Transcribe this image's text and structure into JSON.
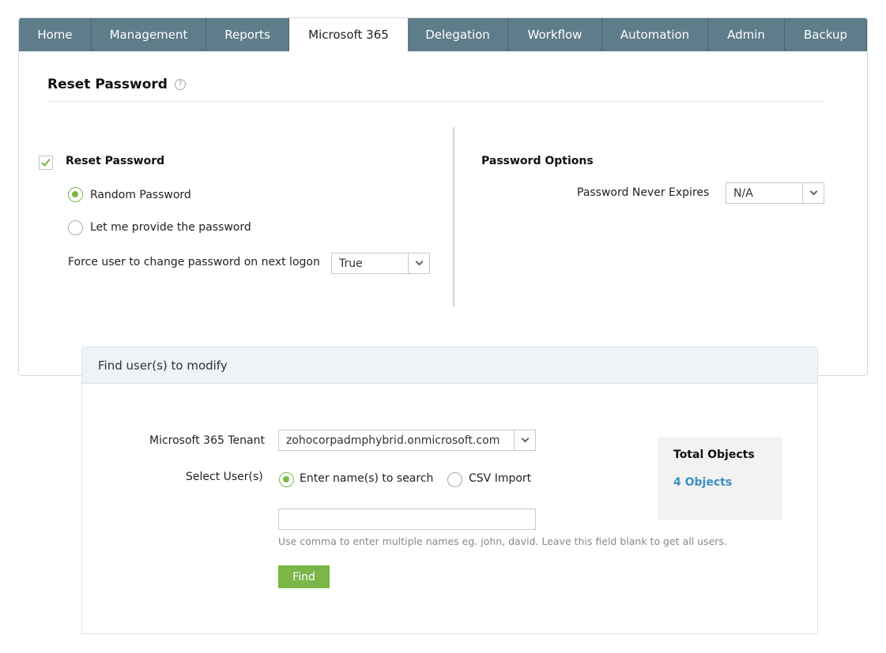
{
  "tabs": [
    {
      "label": "Home",
      "active": false
    },
    {
      "label": "Management",
      "active": false
    },
    {
      "label": "Reports",
      "active": false
    },
    {
      "label": "Microsoft 365",
      "active": true
    },
    {
      "label": "Delegation",
      "active": false
    },
    {
      "label": "Workflow",
      "active": false
    },
    {
      "label": "Automation",
      "active": false
    },
    {
      "label": "Admin",
      "active": false
    },
    {
      "label": "Backup",
      "active": false
    }
  ],
  "page": {
    "title": "Reset Password",
    "help_icon": "question-circle-icon"
  },
  "reset": {
    "checkbox_label": "Reset Password",
    "checked": true,
    "option_random": "Random Password",
    "option_provide": "Let me provide the password",
    "selected_option": "random",
    "force_change_label": "Force user to change password on next logon",
    "force_change_value": "True"
  },
  "password_options": {
    "heading": "Password Options",
    "never_expires_label": "Password Never Expires",
    "never_expires_value": "N/A"
  },
  "find": {
    "header": "Find user(s) to modify",
    "tenant_label": "Microsoft 365 Tenant",
    "tenant_value": "zohocorpadmphybrid.onmicrosoft.com",
    "select_users_label": "Select User(s)",
    "option_search": "Enter name(s) to search",
    "option_csv": "CSV Import",
    "selected_option": "search",
    "names_value": "",
    "hint": "Use comma to enter multiple names eg. john, david. Leave this field blank to get all users.",
    "find_button": "Find"
  },
  "totals": {
    "title": "Total Objects",
    "value": "4 Objects"
  },
  "colors": {
    "tab_bar": "#5e7c8a",
    "accent_green": "#7ab648",
    "link_blue": "#3d8fc2"
  }
}
